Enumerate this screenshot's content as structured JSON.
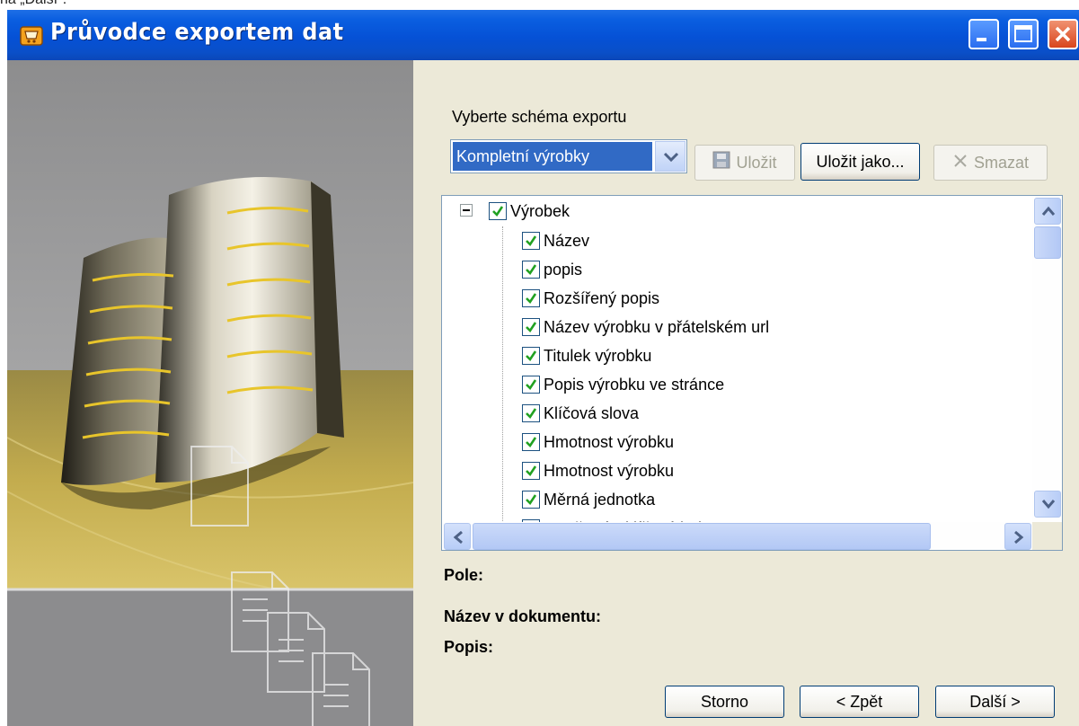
{
  "top_clip_text": "na „Další\".",
  "window": {
    "title": "Průvodce exportem dat",
    "icon": "cart-icon",
    "controls": [
      "minimize-icon",
      "maximize-icon",
      "close-icon"
    ]
  },
  "schema": {
    "label": "Vyberte schéma exportu",
    "selected": "Kompletní výrobky",
    "save_label": "Uložit",
    "save_as_label": "Uložit jako...",
    "delete_label": "Smazat"
  },
  "tree": {
    "root": "Výrobek",
    "items": [
      "Název",
      "popis",
      "Rozšířený popis",
      "Název výrobku v přátelském url",
      "Titulek výrobku",
      "Popis výrobku ve stránce",
      "Klíčová slova",
      "Hmotnost výrobku",
      "Hmotnost výrobku",
      "Měrná jednotka",
      "Množství v klíčové jednotce"
    ]
  },
  "info": {
    "field_label": "Pole:",
    "doc_name_label": "Název v dokumentu:",
    "desc_label": "Popis:"
  },
  "footer": {
    "cancel_label": "Storno",
    "back_label": "< Zpět",
    "next_label": "Další >"
  },
  "colors": {
    "titlebar": "#0551d6",
    "selection": "#316ac5",
    "dialog_bg": "#ece9d8",
    "checkmark": "#21a121"
  }
}
